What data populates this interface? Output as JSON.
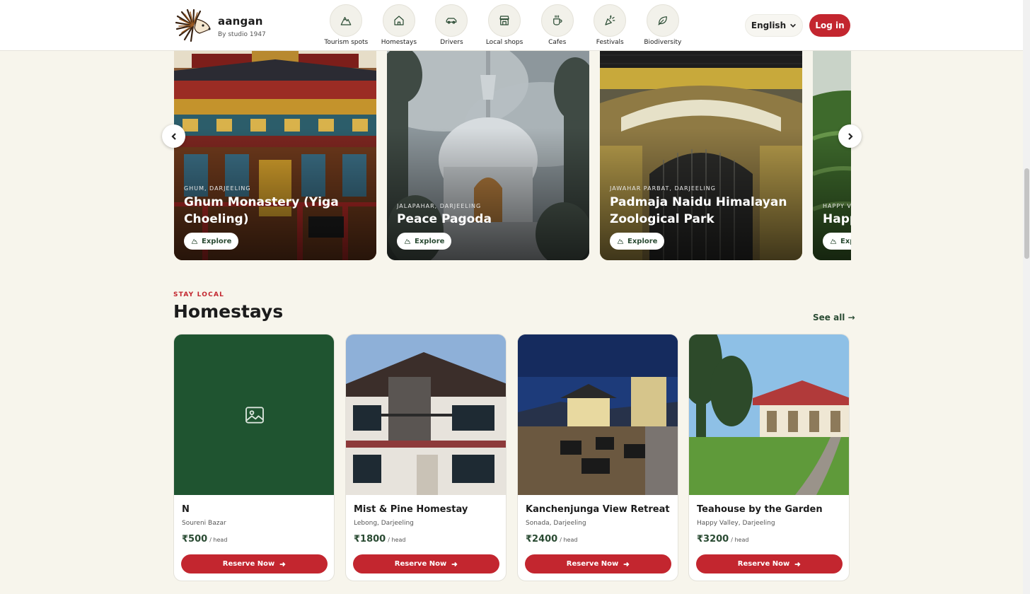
{
  "brand": {
    "name": "aangan",
    "tagline": "By studio 1947"
  },
  "nav": [
    {
      "label": "Tourism spots",
      "icon": "mountain-icon"
    },
    {
      "label": "Homestays",
      "icon": "home-icon"
    },
    {
      "label": "Drivers",
      "icon": "car-icon"
    },
    {
      "label": "Local shops",
      "icon": "store-icon"
    },
    {
      "label": "Cafes",
      "icon": "coffee-icon"
    },
    {
      "label": "Festivals",
      "icon": "party-icon"
    },
    {
      "label": "Biodiversity",
      "icon": "leaf-icon"
    }
  ],
  "language": {
    "selected": "English"
  },
  "login_label": "Log in",
  "spots": [
    {
      "location": "GHUM, DARJEELING",
      "name": "Ghum Monastery (Yiga Choeling)",
      "cta": "Explore"
    },
    {
      "location": "JALAPAHAR, DARJEELING",
      "name": "Peace Pagoda",
      "cta": "Explore"
    },
    {
      "location": "JAWAHAR PARBAT, DARJEELING",
      "name": "Padmaja Naidu Himalayan Zoological Park",
      "cta": "Explore"
    },
    {
      "location": "HAPPY VALLEY, DARJEELING",
      "name": "Happy Valley Tea Estate",
      "cta": "Explore"
    }
  ],
  "homestays_section": {
    "eyebrow": "STAY LOCAL",
    "title": "Homestays",
    "see_all": "See all →"
  },
  "homestays": [
    {
      "name": "N",
      "location": "Soureni Bazar",
      "price": "₹500",
      "unit": "/ head",
      "cta": "Reserve Now"
    },
    {
      "name": "Mist & Pine Homestay",
      "location": "Lebong, Darjeeling",
      "price": "₹1800",
      "unit": "/ head",
      "cta": "Reserve Now"
    },
    {
      "name": "Kanchenjunga View Retreat",
      "location": "Sonada, Darjeeling",
      "price": "₹2400",
      "unit": "/ head",
      "cta": "Reserve Now"
    },
    {
      "name": "Teahouse by the Garden",
      "location": "Happy Valley, Darjeeling",
      "price": "₹3200",
      "unit": "/ head",
      "cta": "Reserve Now"
    }
  ],
  "colors": {
    "accent_red": "#c3262f",
    "brand_green": "#2a4b33",
    "page_bg": "#f7f5ec"
  }
}
